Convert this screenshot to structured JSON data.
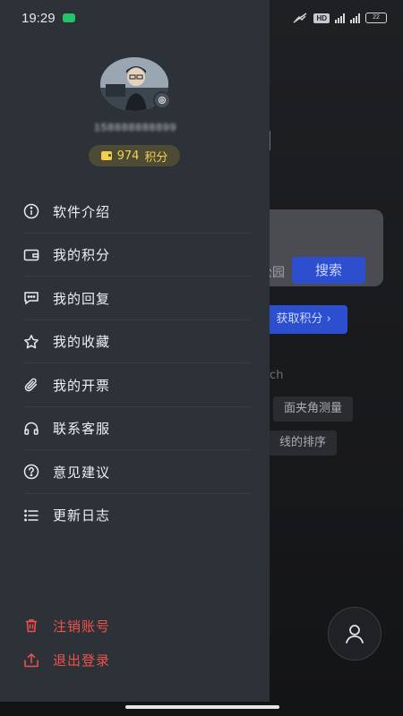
{
  "status_bar": {
    "time": "19:29",
    "hd_tag": "HD",
    "net_1": "5G",
    "net_2": "4G",
    "battery": "22"
  },
  "profile": {
    "username": "158888888899",
    "points_value": "974",
    "points_unit": "积分"
  },
  "menu": {
    "items": [
      {
        "label": "软件介绍",
        "icon": "info-icon"
      },
      {
        "label": "我的积分",
        "icon": "wallet-icon"
      },
      {
        "label": "我的回复",
        "icon": "chat-icon"
      },
      {
        "label": "我的收藏",
        "icon": "star-icon"
      },
      {
        "label": "我的开票",
        "icon": "paperclip-icon"
      },
      {
        "label": "联系客服",
        "icon": "headset-icon"
      },
      {
        "label": "意见建议",
        "icon": "question-icon"
      },
      {
        "label": "更新日志",
        "icon": "list-icon"
      }
    ]
  },
  "danger_menu": {
    "cancel_account": "注销账号",
    "logout": "退出登录"
  },
  "background": {
    "search_hint": "公园",
    "search_button": "搜索",
    "get_points_button": "获取积分 ›",
    "section_label": "rch",
    "tags": [
      "面夹角测量",
      "线的排序"
    ]
  },
  "colors": {
    "drawer": "#2d3239",
    "accent_blue": "#2c4fd0",
    "points_gold": "#f3d04b",
    "danger": "#f0524a"
  }
}
